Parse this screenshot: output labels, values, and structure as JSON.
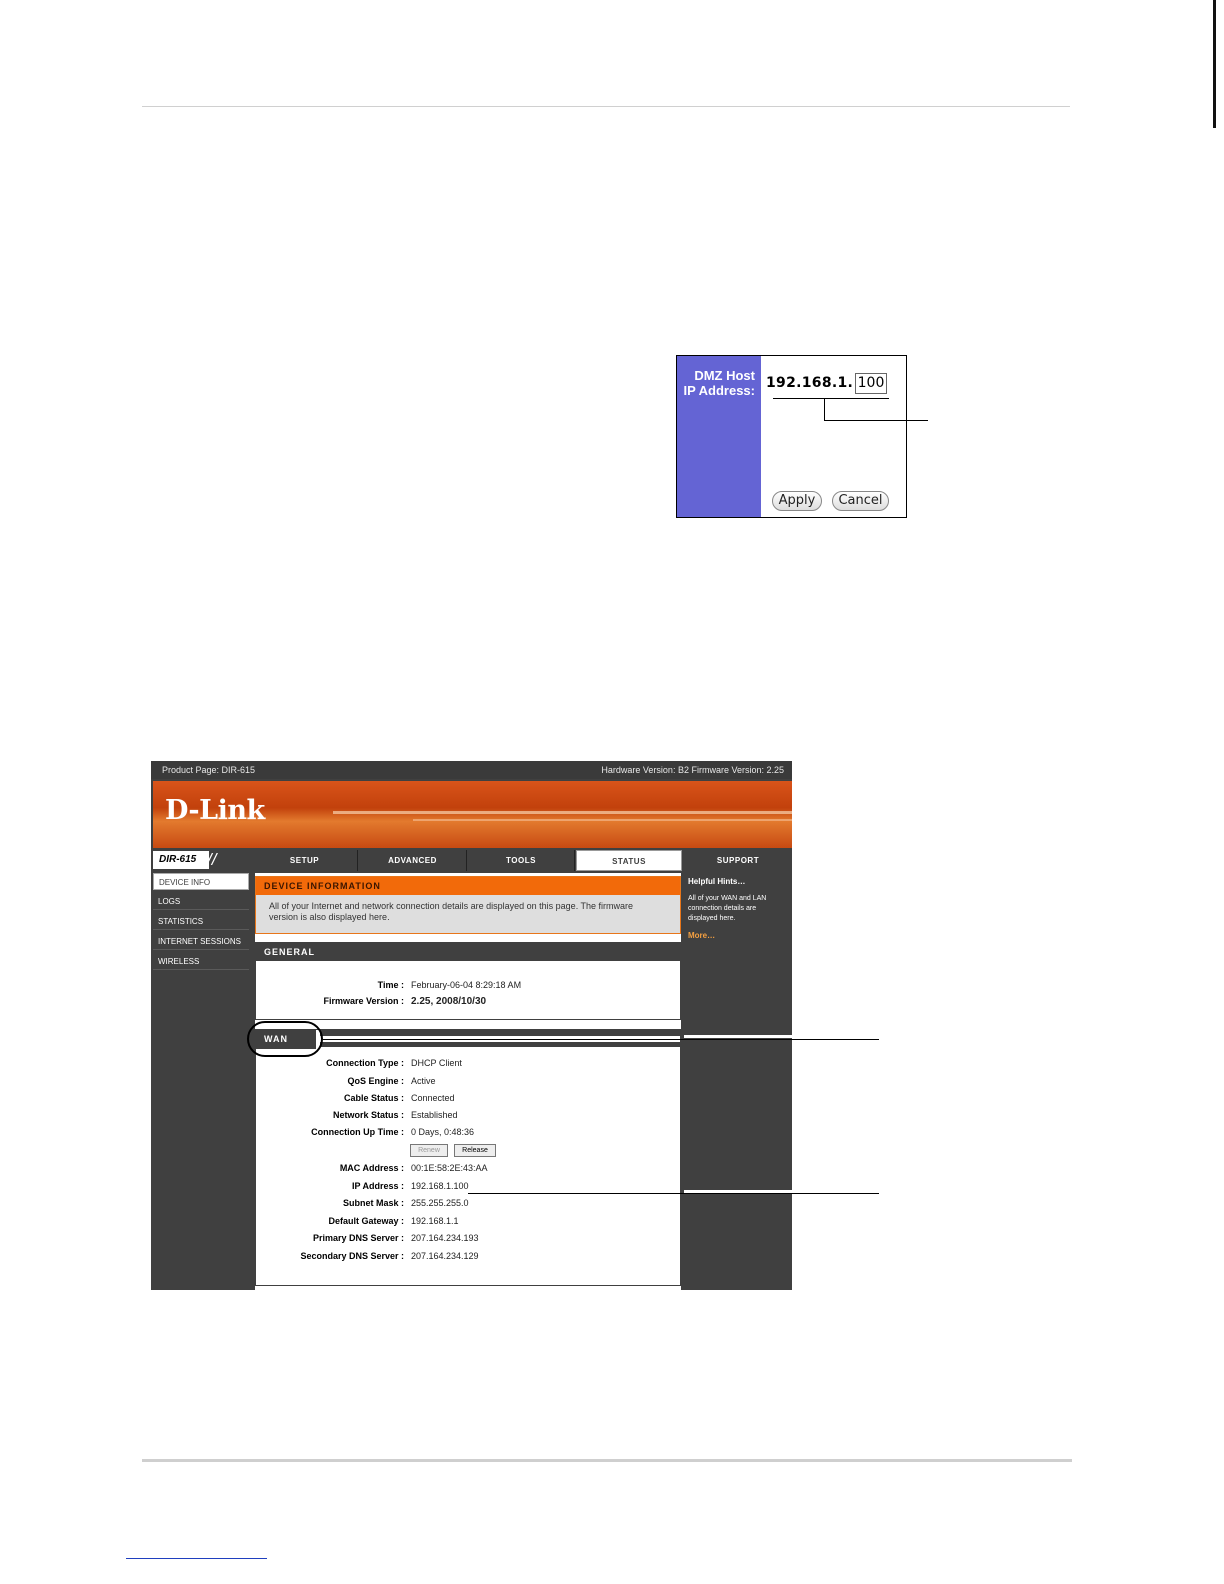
{
  "dmz": {
    "label_line1": "DMZ Host",
    "label_line2": "IP Address:",
    "ip_prefix": "192.168.1.",
    "ip_last": "100",
    "apply": "Apply",
    "cancel": "Cancel",
    "label_color": "#6464d4"
  },
  "router": {
    "product_page": "Product Page: DIR-615",
    "versions": "Hardware Version: B2   Firmware Version: 2.25",
    "logo": "D-Link",
    "model": "DIR-615",
    "nav": [
      "SETUP",
      "ADVANCED",
      "TOOLS",
      "STATUS",
      "SUPPORT"
    ],
    "active_nav": "STATUS",
    "sidebar": [
      "DEVICE INFO",
      "LOGS",
      "STATISTICS",
      "INTERNET SESSIONS",
      "WIRELESS"
    ],
    "device_info": {
      "title": "DEVICE INFORMATION",
      "text": "All of your Internet and network connection details are displayed on this page. The firmware version is also displayed here."
    },
    "general": {
      "title": "GENERAL",
      "time_label": "Time :",
      "time_value": "February-06-04 8:29:18 AM",
      "fw_label": "Firmware Version :",
      "fw_value": "2.25,  2008/10/30"
    },
    "wan": {
      "title": "WAN",
      "rows": [
        {
          "k": "Connection Type :",
          "v": "DHCP Client"
        },
        {
          "k": "QoS Engine :",
          "v": "Active"
        },
        {
          "k": "Cable Status :",
          "v": "Connected"
        },
        {
          "k": "Network Status :",
          "v": "Established"
        },
        {
          "k": "Connection Up Time :",
          "v": "0 Days, 0:48:36"
        }
      ],
      "renew": "Renew",
      "release": "Release",
      "rows2": [
        {
          "k": "MAC Address :",
          "v": "00:1E:58:2E:43:AA"
        },
        {
          "k": "IP Address :",
          "v": "192.168.1.100"
        },
        {
          "k": "Subnet Mask :",
          "v": "255.255.255.0"
        },
        {
          "k": "Default Gateway :",
          "v": "192.168.1.1"
        },
        {
          "k": "Primary DNS Server :",
          "v": "207.164.234.193"
        },
        {
          "k": "Secondary DNS Server :",
          "v": "207.164.234.129"
        }
      ]
    },
    "support": {
      "title": "SUPPORT",
      "hint_title": "Helpful Hints…",
      "hint_text": "All of your WAN and LAN connection details are displayed here.",
      "more": "More…"
    },
    "colors": {
      "orange": "#f26a0a",
      "dark": "#404040"
    }
  }
}
